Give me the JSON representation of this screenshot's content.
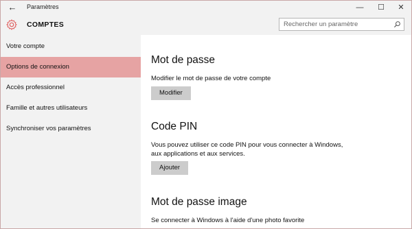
{
  "window": {
    "title": "Paramètres",
    "back_glyph": "←",
    "minimize_glyph": "—",
    "maximize_glyph": "☐",
    "close_glyph": "✕"
  },
  "header": {
    "section_title": "COMPTES",
    "icon": "gear-icon",
    "accent_color": "#e06060",
    "search_placeholder": "Rechercher un paramètre"
  },
  "sidebar": {
    "items": [
      {
        "label": "Votre compte",
        "active": false
      },
      {
        "label": "Options de connexion",
        "active": true
      },
      {
        "label": "Accès professionnel",
        "active": false
      },
      {
        "label": "Famille et autres utilisateurs",
        "active": false
      },
      {
        "label": "Synchroniser vos paramètres",
        "active": false
      }
    ],
    "active_color": "#e6a3a3"
  },
  "content": {
    "password": {
      "heading": "Mot de passe",
      "description": "Modifier le mot de passe de votre compte",
      "button": "Modifier"
    },
    "pin": {
      "heading": "Code PIN",
      "description_line1": "Vous pouvez utiliser ce code PIN pour vous connecter à Windows,",
      "description_line2": "aux applications et aux services.",
      "button": "Ajouter"
    },
    "picture_password": {
      "heading": "Mot de passe image",
      "description": "Se connecter à Windows à l'aide d'une photo favorite"
    }
  }
}
